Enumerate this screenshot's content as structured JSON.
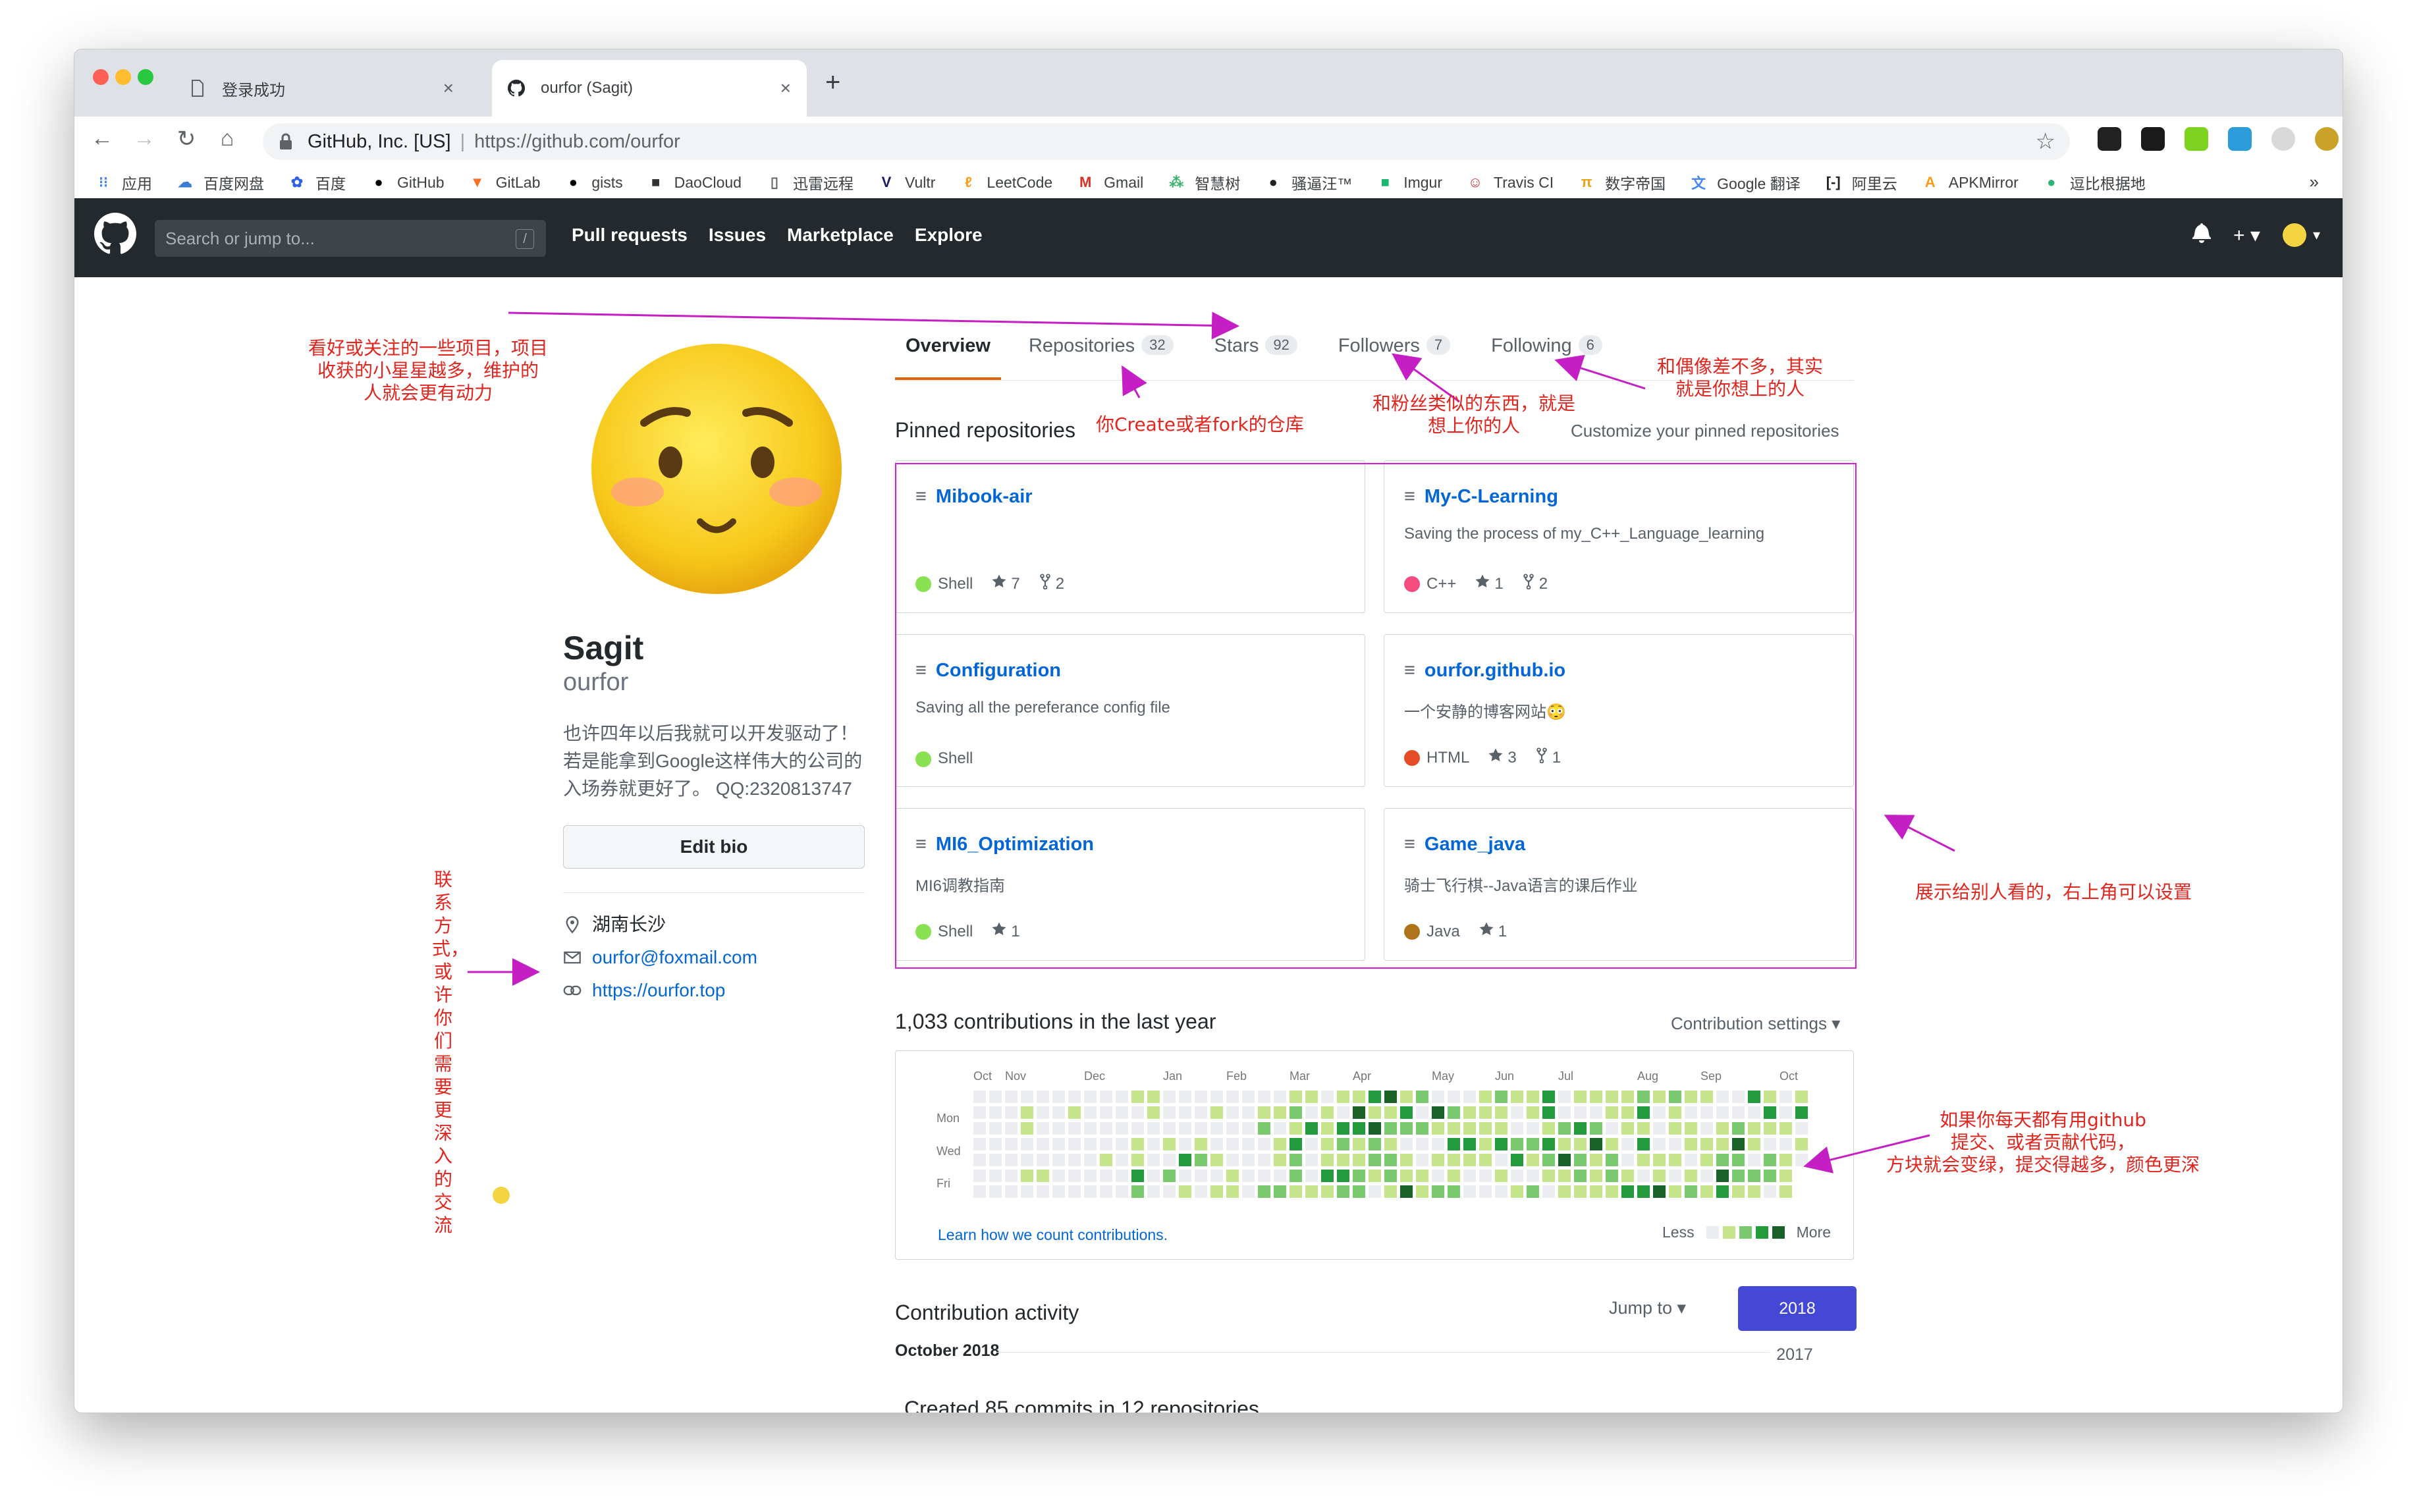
{
  "browser": {
    "tabs": [
      {
        "title": "登录成功",
        "active": false
      },
      {
        "title": "ourfor (Sagit)",
        "active": true
      }
    ],
    "omnibox": {
      "site": "GitHub, Inc. [US]",
      "url": "https://github.com/ourfor"
    },
    "bookmarks": [
      "应用",
      "百度网盘",
      "百度",
      "GitHub",
      "GitLab",
      "gists",
      "DaoCloud",
      "迅雷远程",
      "Vultr",
      "LeetCode",
      "Gmail",
      "智慧树",
      "骚逼汪™",
      "Imgur",
      "Travis CI",
      "数字帝国",
      "Google 翻译",
      "阿里云",
      "APKMirror",
      "逗比根据地"
    ],
    "bookmarks_more": "»"
  },
  "github": {
    "search_placeholder": "Search or jump to...",
    "search_key": "/",
    "nav": [
      "Pull requests",
      "Issues",
      "Marketplace",
      "Explore"
    ]
  },
  "profile": {
    "name": "Sagit",
    "login": "ourfor",
    "bio": "也许四年以后我就可以开发驱动了！若是能拿到Google这样伟大的公司的入场券就更好了。 QQ:2320813747",
    "edit_bio": "Edit bio",
    "location": "湖南长沙",
    "email": "ourfor@foxmail.com",
    "website": "https://ourfor.top"
  },
  "tabs": [
    {
      "label": "Overview",
      "count": null,
      "active": true
    },
    {
      "label": "Repositories",
      "count": "32",
      "active": false
    },
    {
      "label": "Stars",
      "count": "92",
      "active": false
    },
    {
      "label": "Followers",
      "count": "7",
      "active": false
    },
    {
      "label": "Following",
      "count": "6",
      "active": false
    }
  ],
  "pinned": {
    "title": "Pinned repositories",
    "customize": "Customize your pinned repositories",
    "repos": [
      {
        "name": "Mibook-air",
        "desc": "",
        "lang": "Shell",
        "color": "#89e051",
        "stars": "7",
        "forks": "2"
      },
      {
        "name": "My-C-Learning",
        "desc": "Saving the process of my_C++_Language_learning",
        "lang": "C++",
        "color": "#f34b7d",
        "stars": "1",
        "forks": "2"
      },
      {
        "name": "Configuration",
        "desc": "Saving all the pereferance config file",
        "lang": "Shell",
        "color": "#89e051",
        "stars": "",
        "forks": ""
      },
      {
        "name": "ourfor.github.io",
        "desc": "一个安静的博客网站😳",
        "lang": "HTML",
        "color": "#e34c26",
        "stars": "3",
        "forks": "1"
      },
      {
        "name": "MI6_Optimization",
        "desc": "MI6调教指南",
        "lang": "Shell",
        "color": "#89e051",
        "stars": "1",
        "forks": ""
      },
      {
        "name": "Game_java",
        "desc": "骑士飞行棋--Java语言的课后作业",
        "lang": "Java",
        "color": "#b07219",
        "stars": "1",
        "forks": ""
      }
    ]
  },
  "contributions": {
    "title": "1,033 contributions in the last year",
    "settings": "Contribution settings ▾",
    "months": [
      "Oct",
      "Nov",
      "Dec",
      "Jan",
      "Feb",
      "Mar",
      "Apr",
      "May",
      "Jun",
      "Jul",
      "Aug",
      "Sep",
      "Oct"
    ],
    "days": [
      "Mon",
      "Wed",
      "Fri"
    ],
    "learn": "Learn how we count contributions.",
    "less": "Less",
    "more": "More",
    "colors": [
      "#ebedf0",
      "#c6e48b",
      "#7bc96f",
      "#239a3b",
      "#196127"
    ]
  },
  "activity": {
    "title": "Contribution activity",
    "jump": "Jump to ▾",
    "years": [
      "2018",
      "2017"
    ],
    "month": "October 2018",
    "partial": "Created 85 commits in 12 repositories"
  },
  "annotations": {
    "stars": [
      "看好或关注的一些项目，项目",
      "收获的小星星越多，维护的",
      "人就会更有动力"
    ],
    "pinned": "你Create或者fork的仓库",
    "followers": [
      "和粉丝类似的东西，就是",
      "想上你的人"
    ],
    "following": [
      "和偶像差不多，其实",
      "就是你想上的人"
    ],
    "contact": "联系方式，或许你们需要更深入的交流",
    "show": "展示给别人看的，右上角可以设置",
    "calendar": [
      "如果你每天都有用github",
      "提交、或者贡献代码，",
      "方块就会变绿，提交得越多，颜色更深"
    ]
  }
}
